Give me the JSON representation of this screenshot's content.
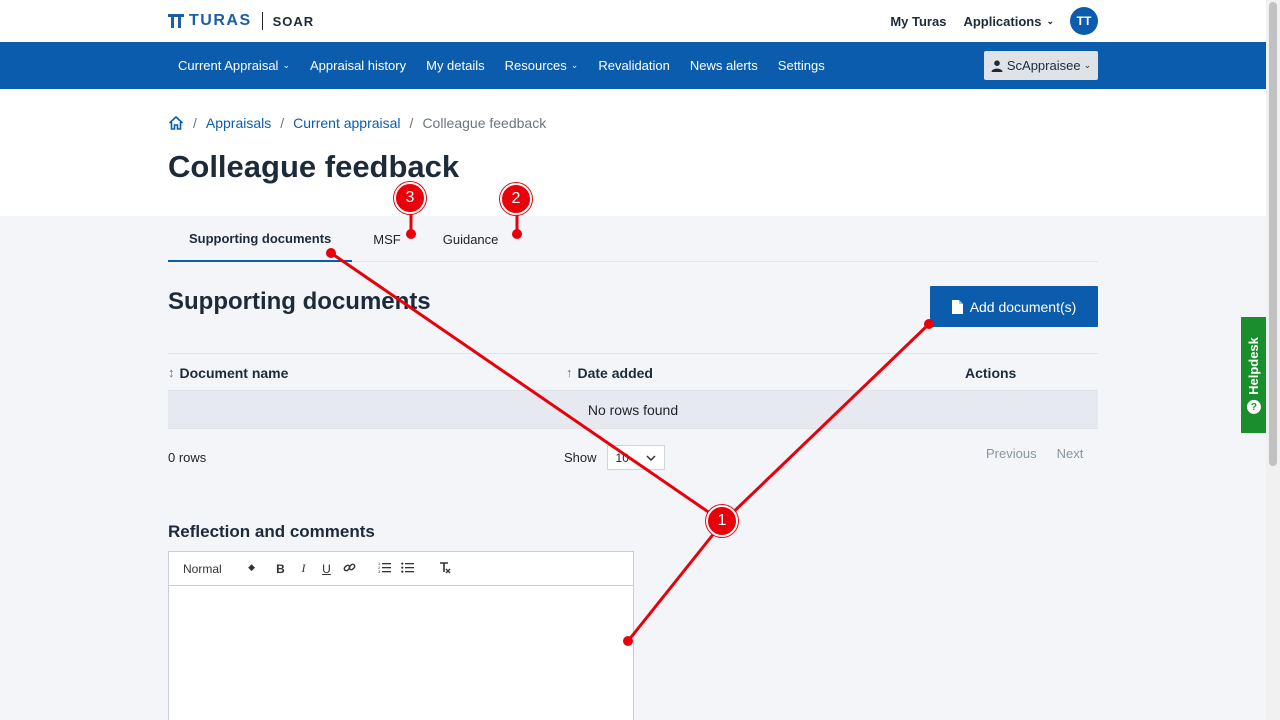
{
  "topbar": {
    "logo_text": "TURAS",
    "app_name": "SOAR",
    "my_turas": "My Turas",
    "applications": "Applications",
    "avatar_initials": "TT"
  },
  "nav": {
    "items": [
      {
        "label": "Current Appraisal",
        "has_dropdown": true
      },
      {
        "label": "Appraisal history",
        "has_dropdown": false
      },
      {
        "label": "My details",
        "has_dropdown": false
      },
      {
        "label": "Resources",
        "has_dropdown": true
      },
      {
        "label": "Revalidation",
        "has_dropdown": false
      },
      {
        "label": "News alerts",
        "has_dropdown": false
      },
      {
        "label": "Settings",
        "has_dropdown": false
      }
    ],
    "user": "ScAppraisee"
  },
  "breadcrumb": {
    "items": [
      "Appraisals",
      "Current appraisal"
    ],
    "current": "Colleague feedback"
  },
  "page_title": "Colleague feedback",
  "tabs": [
    {
      "label": "Supporting documents",
      "active": true
    },
    {
      "label": "MSF",
      "active": false
    },
    {
      "label": "Guidance",
      "active": false
    }
  ],
  "section": {
    "title": "Supporting documents",
    "add_button": "Add document(s)"
  },
  "table": {
    "columns": [
      "Document name",
      "Date added",
      "Actions"
    ],
    "empty_message": "No rows found",
    "rows_count": "0 rows",
    "show_label": "Show",
    "page_size": "10",
    "previous": "Previous",
    "next": "Next"
  },
  "reflection": {
    "title": "Reflection and comments",
    "format": "Normal",
    "buttons": [
      "B",
      "I",
      "U"
    ]
  },
  "helpdesk": "Helpdesk",
  "annotations": [
    "1",
    "2",
    "3"
  ],
  "colors": {
    "primary": "#0b5cad",
    "helpdesk": "#1a8e2c",
    "annotation": "#e8000b",
    "main_bg": "#f3f5f8"
  }
}
